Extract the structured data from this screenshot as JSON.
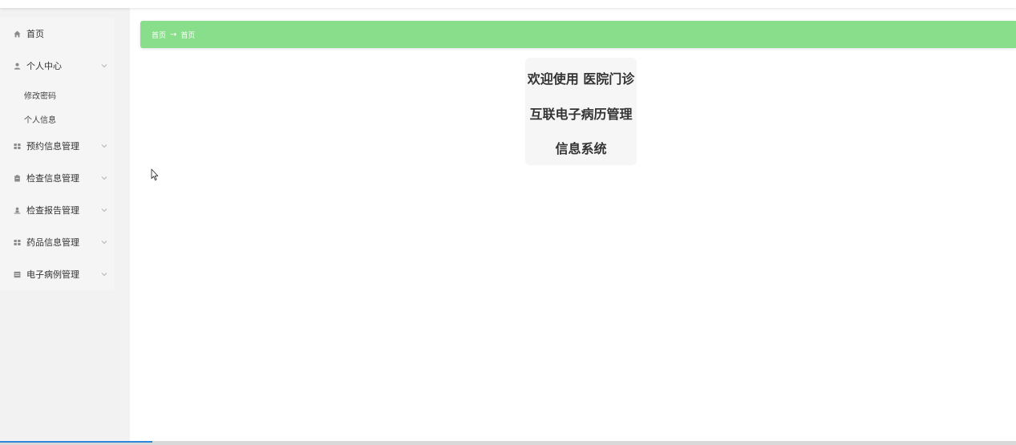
{
  "breadcrumb": {
    "items": [
      "首页",
      "首页"
    ],
    "separator": "→"
  },
  "sidebar": {
    "items": [
      {
        "label": "首页",
        "icon": "home-icon",
        "has_children": false
      },
      {
        "label": "个人中心",
        "icon": "user-icon",
        "has_children": true,
        "expanded": true,
        "children": [
          {
            "label": "修改密码"
          },
          {
            "label": "个人信息"
          }
        ]
      },
      {
        "label": "预约信息管理",
        "icon": "grid-icon",
        "has_children": true
      },
      {
        "label": "检查信息管理",
        "icon": "clipboard-icon",
        "has_children": true
      },
      {
        "label": "检查报告管理",
        "icon": "person-icon",
        "has_children": true
      },
      {
        "label": "药品信息管理",
        "icon": "grid-icon",
        "has_children": true
      },
      {
        "label": "电子病例管理",
        "icon": "chart-icon",
        "has_children": true
      }
    ]
  },
  "welcome": {
    "lines": [
      "欢迎使用 医院门诊",
      "互联电子病历管理",
      "信息系统"
    ]
  },
  "colors": {
    "breadcrumb_bg": "#88de8a",
    "sidebar_bg": "#f2f2f2",
    "icon_gray": "#8a8a8a",
    "progress_blue": "#2f86d9"
  }
}
